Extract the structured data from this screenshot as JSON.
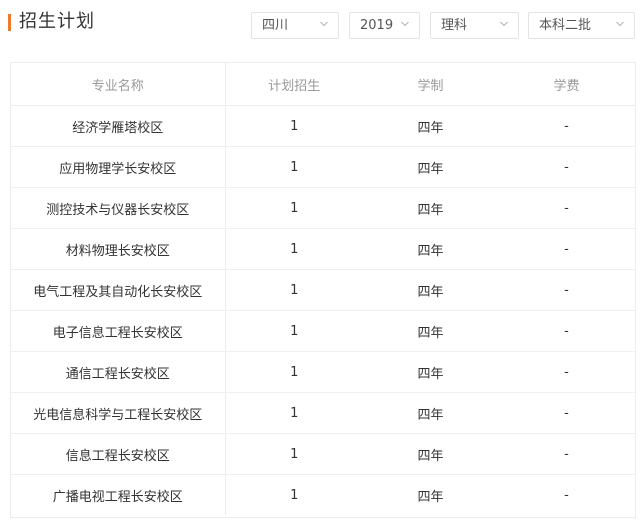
{
  "header": {
    "title": "招生计划"
  },
  "filters": {
    "province": "四川",
    "year": "2019",
    "subject": "理科",
    "batch": "本科二批"
  },
  "table": {
    "columns": [
      "专业名称",
      "计划招生",
      "学制",
      "学费"
    ],
    "rows": [
      {
        "major": "经济学雁塔校区",
        "plan": "1",
        "duration": "四年",
        "fee": "-"
      },
      {
        "major": "应用物理学长安校区",
        "plan": "1",
        "duration": "四年",
        "fee": "-"
      },
      {
        "major": "测控技术与仪器长安校区",
        "plan": "1",
        "duration": "四年",
        "fee": "-"
      },
      {
        "major": "材料物理长安校区",
        "plan": "1",
        "duration": "四年",
        "fee": "-"
      },
      {
        "major": "电气工程及其自动化长安校区",
        "plan": "1",
        "duration": "四年",
        "fee": "-"
      },
      {
        "major": "电子信息工程长安校区",
        "plan": "1",
        "duration": "四年",
        "fee": "-"
      },
      {
        "major": "通信工程长安校区",
        "plan": "1",
        "duration": "四年",
        "fee": "-"
      },
      {
        "major": "光电信息科学与工程长安校区",
        "plan": "1",
        "duration": "四年",
        "fee": "-"
      },
      {
        "major": "信息工程长安校区",
        "plan": "1",
        "duration": "四年",
        "fee": "-"
      },
      {
        "major": "广播电视工程长安校区",
        "plan": "1",
        "duration": "四年",
        "fee": "-"
      }
    ]
  },
  "colors": {
    "accent": "#f0792e",
    "header_text": "#999999",
    "body_text": "#333333",
    "border": "#ececec"
  },
  "icons": {
    "dropdown": "chevron-down-icon"
  }
}
